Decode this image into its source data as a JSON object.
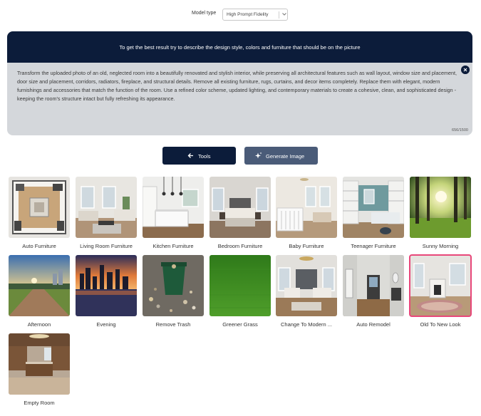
{
  "model": {
    "label": "Model type",
    "value": "High Prompt Fidelity"
  },
  "banner": {
    "text": "To get the best result try to describe the design style, colors and furniture that should be on the picture"
  },
  "prompt": {
    "text": "Transform the uploaded photo of an old, neglected room into a beautifully renovated and stylish interior, while preserving all architectural features such as wall layout, window size and placement, door size and placement, corridors, radiators, fireplace, and structural details. Remove all existing furniture, rugs, curtains, and decor items completely. Replace them with elegant, modern furnishings and accessories that match the function of the room. Use a refined color scheme, updated lighting, and contemporary materials to create a cohesive, clean, and sophisticated design - keeping the room's structure intact but fully refreshing its appearance.",
    "counter": "656/1500"
  },
  "buttons": {
    "tools": "Tools",
    "generate": "Generate Image"
  },
  "presets": [
    {
      "label": "Auto Furniture",
      "image": "floorplan-topdown"
    },
    {
      "label": "Living Room Furniture",
      "image": "living-room"
    },
    {
      "label": "Kitchen Furniture",
      "image": "kitchen"
    },
    {
      "label": "Bedroom Furniture",
      "image": "bedroom"
    },
    {
      "label": "Baby Furniture",
      "image": "nursery"
    },
    {
      "label": "Teenager Furniture",
      "image": "teen-room"
    },
    {
      "label": "Sunny Morning",
      "image": "sunny-forest"
    },
    {
      "label": "Afternoon",
      "image": "park-path"
    },
    {
      "label": "Evening",
      "image": "city-skyline-dusk"
    },
    {
      "label": "Remove Trash",
      "image": "trash-bin"
    },
    {
      "label": "Greener Grass",
      "image": "grass"
    },
    {
      "label": "Change To Modern ...",
      "image": "modern-living"
    },
    {
      "label": "Auto Remodel",
      "image": "empty-hallway"
    },
    {
      "label": "Old To New Look",
      "image": "fireplace-room",
      "selected": true
    },
    {
      "label": "Empty Room",
      "image": "empty-kitchen"
    }
  ],
  "colors": {
    "navy": "#0c1c3a",
    "slate": "#4a5b78",
    "selected_border": "#e8477a",
    "prompt_bg": "#d4d7db"
  }
}
